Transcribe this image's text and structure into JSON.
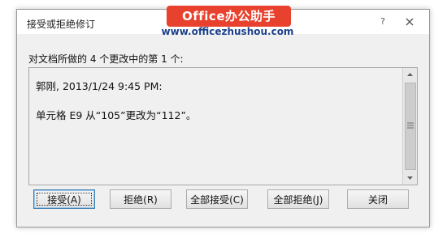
{
  "dialog": {
    "title": "接受或拒绝修订",
    "help_label": "?",
    "prompt": "对文档所做的 4 个更改中的第 1 个:",
    "detail": {
      "line1": "郭刚, 2013/1/24 9:45 PM:",
      "line2": "单元格 E9 从“105”更改为“112”。"
    },
    "buttons": {
      "accept": "接受(A)",
      "reject": "拒绝(R)",
      "accept_all": "全部接受(C)",
      "reject_all": "全部拒绝(J)",
      "close": "关闭"
    }
  },
  "watermark": {
    "brand": "Office办公助手",
    "url": "www.officezhushou.com"
  },
  "colors": {
    "watermark_bg": "#e8422f",
    "watermark_url": "#1b3f8a",
    "dialog_bg": "#f0f0f0",
    "default_button_border": "#3c7fb1"
  },
  "icons": [
    "close-icon",
    "scroll-up-arrow-icon",
    "scroll-down-arrow-icon",
    "scroll-grip-icon"
  ]
}
